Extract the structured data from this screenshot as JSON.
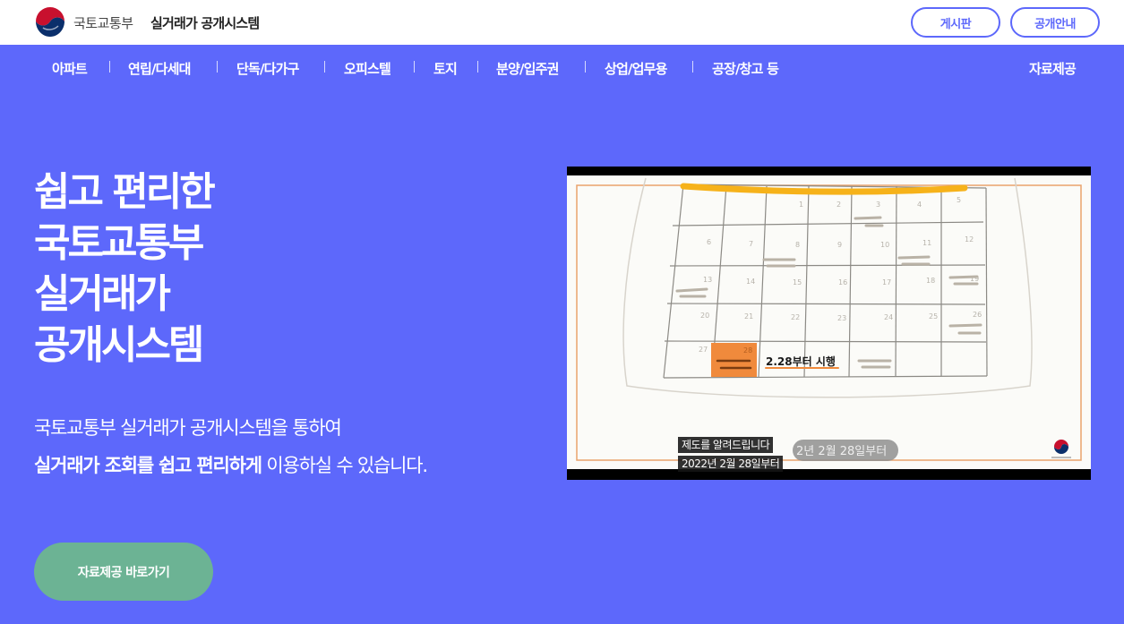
{
  "header": {
    "ministry": "국토교통부",
    "site_title": "실거래가 공개시스템",
    "buttons": {
      "board": "게시판",
      "guide": "공개안내"
    }
  },
  "nav": {
    "items": [
      "아파트",
      "연립/다세대",
      "단독/다가구",
      "오피스텔",
      "토지",
      "분양/입주권",
      "상업/업무용",
      "공장/창고 등"
    ],
    "data_link": "자료제공"
  },
  "hero": {
    "title_lines": [
      "쉽고 편리한",
      "국토교통부",
      "실거래가",
      "공개시스템"
    ],
    "desc_line1": "국토교통부 실거래가 공개시스템을 통하여",
    "desc_line2_bold": "실거래가 조회를 쉽고 편리하게",
    "desc_line2_rest": " 이용하실 수 있습니다.",
    "cta_label": "자료제공 바로가기"
  },
  "video": {
    "calendar_label": "2.28부터 시행",
    "background_caption": "2년 2월 28일부터",
    "subtitle_line1": "제도를 알려드립니다",
    "subtitle_line2": "2022년 2월 28일부터"
  },
  "colors": {
    "brand_blue": "#5d68fb",
    "cta_green": "#6cb394",
    "highlight_orange": "#f08a3c",
    "calendar_yellow": "#f6b21a"
  }
}
